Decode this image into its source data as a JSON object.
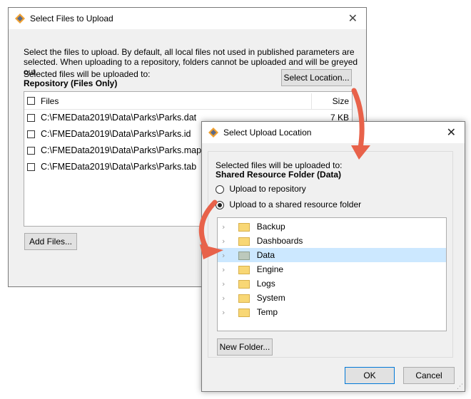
{
  "upload_dialog": {
    "title": "Select Files to Upload",
    "instructions": "Select the files to upload. By default, all local files not used in published parameters are selected. When uploading to a repository, folders cannot be uploaded and will be greyed out.",
    "destination_label": "Selected files will be uploaded to:",
    "destination_value": "Repository (Files Only)",
    "select_location_label": "Select Location...",
    "table": {
      "col_files": "Files",
      "col_size": "Size",
      "rows": [
        {
          "file": "C:\\FMEData2019\\Data\\Parks\\Parks.dat",
          "size": "7 KB"
        },
        {
          "file": "C:\\FMEData2019\\Data\\Parks\\Parks.id",
          "size": ""
        },
        {
          "file": "C:\\FMEData2019\\Data\\Parks\\Parks.map",
          "size": ""
        },
        {
          "file": "C:\\FMEData2019\\Data\\Parks\\Parks.tab",
          "size": ""
        }
      ]
    },
    "add_files_label": "Add Files..."
  },
  "location_dialog": {
    "title": "Select Upload Location",
    "destination_label": "Selected files will be uploaded to:",
    "destination_value": "Shared Resource Folder (Data)",
    "option_repository": "Upload to repository",
    "option_shared": "Upload to a shared resource folder",
    "folders": [
      "Backup",
      "Dashboards",
      "Data",
      "Engine",
      "Logs",
      "System",
      "Temp"
    ],
    "selected_folder": "Data",
    "new_folder_label": "New Folder...",
    "ok_label": "OK",
    "cancel_label": "Cancel"
  },
  "colors": {
    "arrow": "#e8624a",
    "selection": "#cce8ff",
    "accent": "#0078d7"
  }
}
